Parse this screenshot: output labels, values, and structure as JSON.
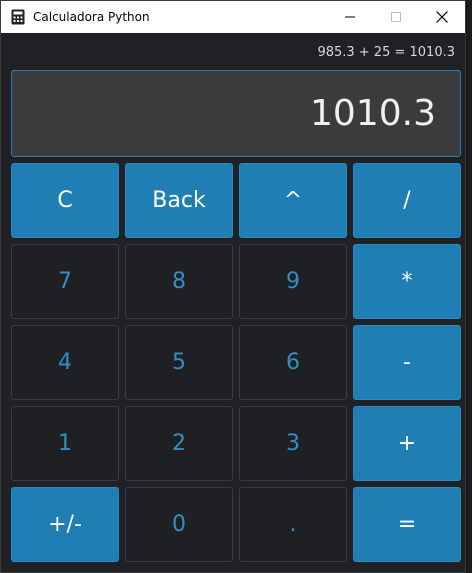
{
  "window": {
    "title": "Calculadora Python"
  },
  "display": {
    "expression": "985.3 + 25 = 1010.3",
    "value": "1010.3"
  },
  "keys": [
    {
      "label": "C",
      "name": "clear-button",
      "style": "accent"
    },
    {
      "label": "Back",
      "name": "backspace-button",
      "style": "accent"
    },
    {
      "label": "^",
      "name": "power-button",
      "style": "accent"
    },
    {
      "label": "/",
      "name": "divide-button",
      "style": "accent"
    },
    {
      "label": "7",
      "name": "digit-7-button",
      "style": "digit"
    },
    {
      "label": "8",
      "name": "digit-8-button",
      "style": "digit"
    },
    {
      "label": "9",
      "name": "digit-9-button",
      "style": "digit"
    },
    {
      "label": "*",
      "name": "multiply-button",
      "style": "accent"
    },
    {
      "label": "4",
      "name": "digit-4-button",
      "style": "digit"
    },
    {
      "label": "5",
      "name": "digit-5-button",
      "style": "digit"
    },
    {
      "label": "6",
      "name": "digit-6-button",
      "style": "digit"
    },
    {
      "label": "-",
      "name": "subtract-button",
      "style": "accent"
    },
    {
      "label": "1",
      "name": "digit-1-button",
      "style": "digit"
    },
    {
      "label": "2",
      "name": "digit-2-button",
      "style": "digit"
    },
    {
      "label": "3",
      "name": "digit-3-button",
      "style": "digit"
    },
    {
      "label": "+",
      "name": "add-button",
      "style": "accent"
    },
    {
      "label": "+/-",
      "name": "negate-button",
      "style": "accent"
    },
    {
      "label": "0",
      "name": "digit-0-button",
      "style": "digit"
    },
    {
      "label": ".",
      "name": "decimal-point-button",
      "style": "digit"
    },
    {
      "label": "=",
      "name": "equals-button",
      "style": "accent"
    }
  ],
  "colors": {
    "accent": "#1f7fb4",
    "digit_text": "#2f8fc8",
    "background": "#202124",
    "display_bg": "#3a3b3d"
  },
  "icons": {
    "app": "calculator-icon",
    "minimize": "minimize-icon",
    "maximize": "maximize-icon",
    "close": "close-icon"
  }
}
